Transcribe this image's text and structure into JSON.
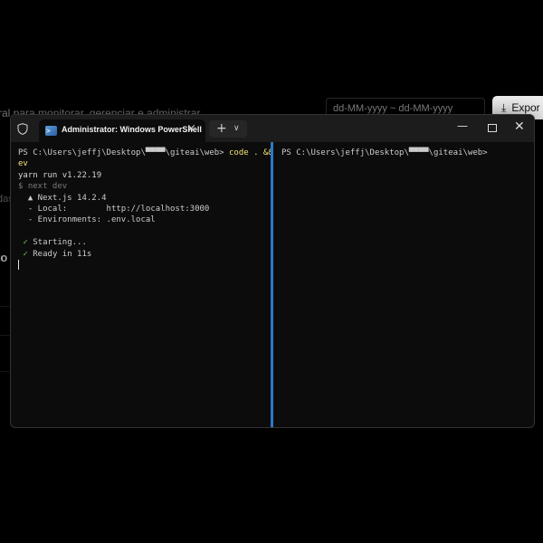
{
  "background": {
    "description_fragment": "ral para monitorar, gerenciar e administrar",
    "date_range_placeholder": "dd-MM-yyyy ~ dd-MM-yyyy",
    "export_button_label": "Expor",
    "fragment_das": "das",
    "fragment_to": "to"
  },
  "window": {
    "tab_title": "Administrator: Windows PowerShell",
    "new_tab_label": "+",
    "dropdown_glyph": "⌄"
  },
  "left_pane": {
    "prompt": "PS C:\\Users\\jeffj\\Desktop\\▀▀▀▀\\giteai\\web>",
    "command": " code . && yarn d",
    "command_wrap": "ev",
    "yarn_version": "yarn run v1.22.19",
    "run_command": "$ next dev",
    "nextjs_line": "  ▲ Next.js 14.2.4",
    "local_label": "  - Local:        ",
    "local_url": "http://localhost:3000",
    "env_line": "  - Environments: .env.local",
    "starting_line": "Starting...",
    "ready_line": "Ready in 11s",
    "check": " ✓ "
  },
  "right_pane": {
    "prompt": "PS C:\\Users\\jeffj\\Desktop\\▀▀▀▀\\giteai\\web>"
  },
  "colors": {
    "divider": "#2b79c7",
    "command": "#f2e47a",
    "success": "#79c15a"
  }
}
